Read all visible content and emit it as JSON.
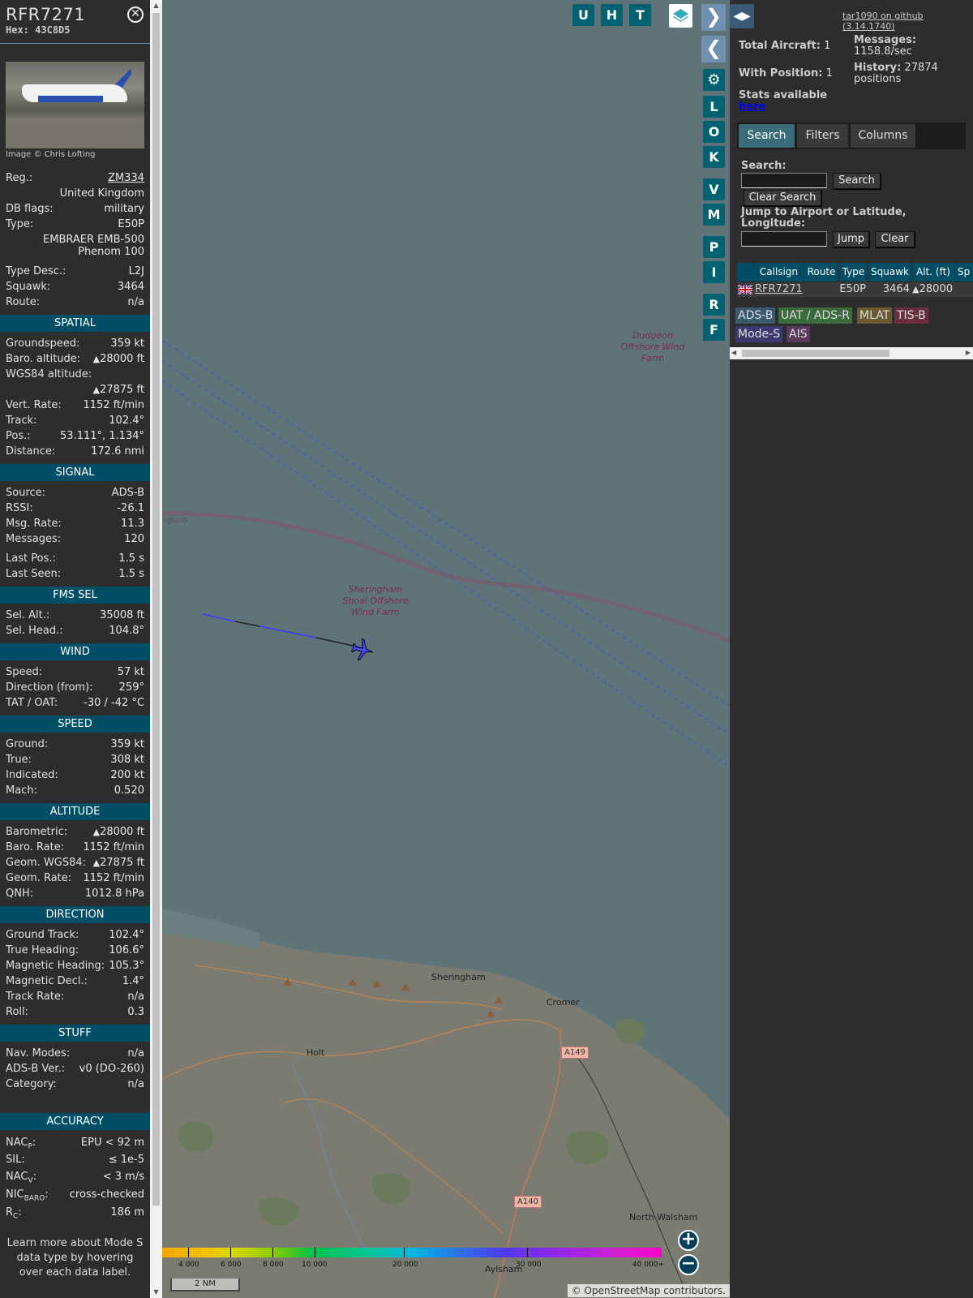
{
  "sidebar": {
    "callsign": "RFR7271",
    "hex_label": "Hex:",
    "hex": "43C8D5",
    "photo_credit": "Image © Chris Lofting",
    "info": {
      "reg_label": "Reg.:",
      "reg": "ZM334",
      "country": "United Kingdom",
      "dbflags_label": "DB flags:",
      "dbflags": "military",
      "type_label": "Type:",
      "type": "E50P",
      "type_full": "EMBRAER EMB-500 Phenom 100",
      "typedesc_label": "Type Desc.:",
      "typedesc": "L2J",
      "squawk_label": "Squawk:",
      "squawk": "3464",
      "route_label": "Route:",
      "route": "n/a"
    },
    "spatial": {
      "title": "SPATIAL",
      "gs_label": "Groundspeed:",
      "gs": "359 kt",
      "baro_label": "Baro. altitude:",
      "baro": "28000 ft",
      "wgs_label": "WGS84 altitude:",
      "wgs": "27875 ft",
      "vr_label": "Vert. Rate:",
      "vr": "1152 ft/min",
      "track_label": "Track:",
      "track": "102.4°",
      "pos_label": "Pos.:",
      "pos": "53.111°, 1.134°",
      "dist_label": "Distance:",
      "dist": "172.6 nmi"
    },
    "signal": {
      "title": "SIGNAL",
      "source_label": "Source:",
      "source": "ADS-B",
      "rssi_label": "RSSI:",
      "rssi": "-26.1",
      "msgrate_label": "Msg. Rate:",
      "msgrate": "11.3",
      "messages_label": "Messages:",
      "messages": "120",
      "lastpos_label": "Last Pos.:",
      "lastpos": "1.5 s",
      "lastseen_label": "Last Seen:",
      "lastseen": "1.5 s"
    },
    "fms": {
      "title": "FMS SEL",
      "selalt_label": "Sel. Alt.:",
      "selalt": "35008 ft",
      "selhead_label": "Sel. Head.:",
      "selhead": "104.8°"
    },
    "wind": {
      "title": "WIND",
      "speed_label": "Speed:",
      "speed": "57 kt",
      "dir_label": "Direction (from):",
      "dir": "259°",
      "tat_label": "TAT / OAT:",
      "tat": "-30 / -42 °C"
    },
    "speed": {
      "title": "SPEED",
      "ground_label": "Ground:",
      "ground": "359 kt",
      "true_label": "True:",
      "true": "308 kt",
      "ind_label": "Indicated:",
      "ind": "200 kt",
      "mach_label": "Mach:",
      "mach": "0.520"
    },
    "altitude": {
      "title": "ALTITUDE",
      "baro_label": "Barometric:",
      "baro": "28000 ft",
      "barorate_label": "Baro. Rate:",
      "barorate": "1152 ft/min",
      "geom_label": "Geom. WGS84:",
      "geom": "27875 ft",
      "geomrate_label": "Geom. Rate:",
      "geomrate": "1152 ft/min",
      "qnh_label": "QNH:",
      "qnh": "1012.8 hPa"
    },
    "direction": {
      "title": "DIRECTION",
      "gt_label": "Ground Track:",
      "gt": "102.4°",
      "th_label": "True Heading:",
      "th": "106.6°",
      "mh_label": "Magnetic Heading:",
      "mh": "105.3°",
      "md_label": "Magnetic Decl.:",
      "md": "1.4°",
      "tr_label": "Track Rate:",
      "tr": "n/a",
      "roll_label": "Roll:",
      "roll": "0.3"
    },
    "stuff": {
      "title": "STUFF",
      "nav_label": "Nav. Modes:",
      "nav": "n/a",
      "adsb_label": "ADS-B Ver.:",
      "adsb": "v0 (DO-260)",
      "cat_label": "Category:",
      "cat": "n/a"
    },
    "accuracy": {
      "title": "ACCURACY",
      "nacp_label": "NAC",
      "nacp_sub": "P",
      "nacp": "EPU < 92 m",
      "sil_label": "SIL:",
      "sil": "≤ 1e-5",
      "nacv_label": "NAC",
      "nacv_sub": "V",
      "nacv": "< 3 m/s",
      "nic_label": "NIC",
      "nic_sub": "BARO",
      "nic": "cross-checked",
      "rc_label": "R",
      "rc_sub": "C",
      "rc": "186 m"
    },
    "footer": "Learn more about Mode S data type by hovering over each data label."
  },
  "map": {
    "top_buttons": [
      "U",
      "H",
      "T"
    ],
    "side_buttons": [
      "L",
      "O",
      "K",
      "V",
      "M",
      "P",
      "I",
      "R",
      "F"
    ],
    "labels": {
      "dudgeon": "Dudgeon Offshore Wind Farm",
      "sheringham_shoal": "Sheringham Shoal Offshore Wind Farm",
      "england": "ngland",
      "sheringham": "Sheringham",
      "cromer": "Cromer",
      "holt": "Holt",
      "north_walsham": "North Walsham",
      "aylsham": "Aylsham",
      "a149": "A149",
      "a140": "A140"
    },
    "colorbar_ticks": [
      "4 000",
      "6 000",
      "8 000",
      "10 000",
      "20 000",
      "30 000",
      "40 000+"
    ],
    "scale": "2 NM",
    "attribution_prefix": "© ",
    "attribution_link": "OpenStreetMap",
    "attribution_suffix": " contributors.",
    "colors": {
      "sea": "#5e7479",
      "land": "#7a7a70",
      "button": "#006270"
    }
  },
  "right": {
    "github": "tar1090 on github (3.14.1740)",
    "total_label": "Total Aircraft:",
    "total": "1",
    "withpos_label": "With Position:",
    "withpos": "1",
    "stats_label": "Stats available",
    "stats_link": "here",
    "messages_label": "Messages:",
    "messages": "1158.8/sec",
    "history_label": "History:",
    "history": "27874 positions",
    "tabs": [
      "Search",
      "Filters",
      "Columns"
    ],
    "search_label": "Search:",
    "search_button": "Search",
    "clear_search_button": "Clear Search",
    "jump_label": "Jump to Airport or Latitude, Longitude:",
    "jump_button": "Jump",
    "clear_button": "Clear",
    "table": {
      "headers": [
        "Callsign",
        "Route",
        "Type",
        "Squawk",
        "Alt. (ft)",
        "Sp"
      ],
      "row": {
        "callsign": "RFR7271",
        "route": "",
        "type": "E50P",
        "squawk": "3464",
        "alt": "28000"
      }
    },
    "badges": [
      "ADS-B",
      "UAT / ADS-R",
      "MLAT",
      "TIS-B",
      "Mode-S",
      "AIS"
    ]
  }
}
